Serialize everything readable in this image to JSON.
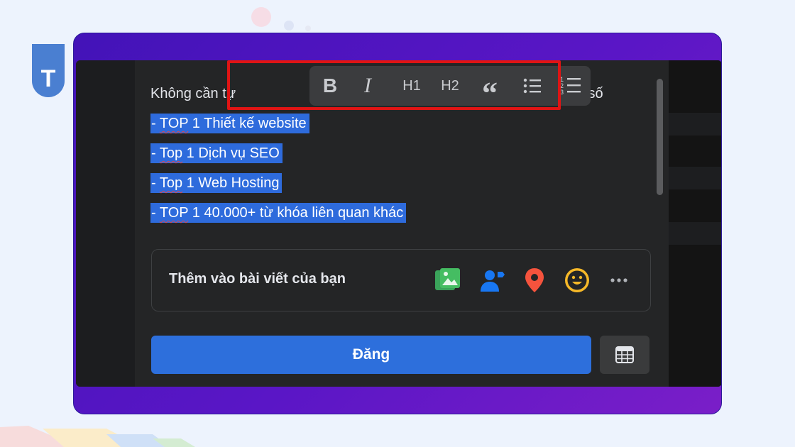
{
  "brand": {
    "badge_letter": "T",
    "badge_color": "#4a7fd1"
  },
  "editor": {
    "first_line_left": "Không cần tự",
    "first_line_right": "các con số",
    "lines": [
      {
        "prefix": "- ",
        "wavy": "TOP",
        "rest": " 1 Thiết kế website"
      },
      {
        "prefix": "- ",
        "wavy": "Top",
        "rest": " 1 Dịch vụ SEO"
      },
      {
        "prefix": "- ",
        "wavy": "Top",
        "rest": " 1 Web Hosting"
      },
      {
        "prefix": "- ",
        "wavy": "TOP",
        "rest": " 1 40.000+  từ khóa liên quan khác"
      }
    ],
    "selection_color": "#2e6bdc"
  },
  "toolbar": {
    "bold": "B",
    "italic": "I",
    "h1": "H1",
    "h2": "H2",
    "quote": "“",
    "bullet_icon": "bullet-list-icon",
    "numbered_icon": "numbered-list-icon",
    "highlight_color": "#e01414"
  },
  "add_to_post": {
    "label": "Thêm vào bài viết của bạn",
    "icons": [
      "photo-icon",
      "tag-people-icon",
      "location-icon",
      "feeling-icon",
      "more-icon"
    ]
  },
  "actions": {
    "post_label": "Đăng",
    "post_color": "#2d6fdc",
    "schedule_icon": "calendar-icon"
  }
}
